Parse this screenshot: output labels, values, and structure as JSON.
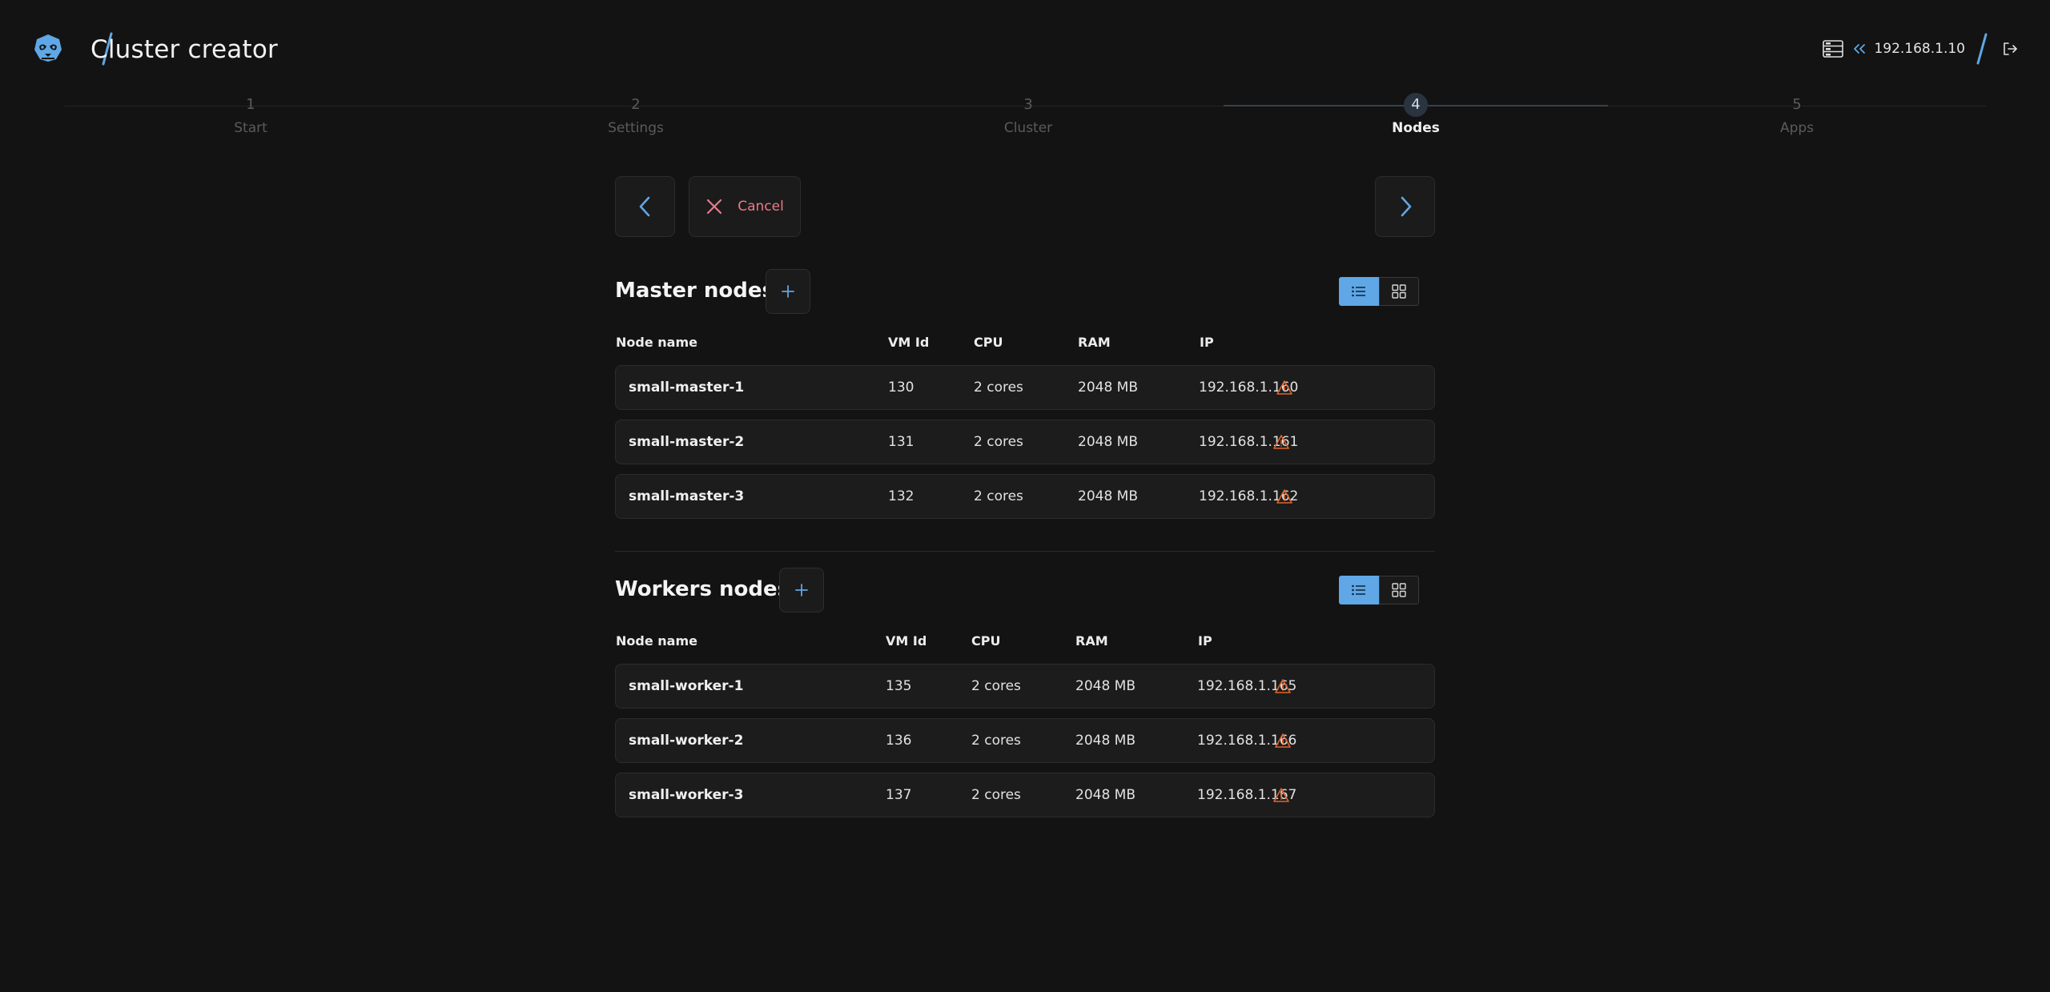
{
  "header": {
    "title": "Cluster creator",
    "host": "192.168.1.10"
  },
  "colors": {
    "accent": "#5fa7e6",
    "cancel": "#e97a8a",
    "warning": "#e0642c",
    "background": "#131313"
  },
  "steps": [
    {
      "num": "1",
      "label": "Start"
    },
    {
      "num": "2",
      "label": "Settings"
    },
    {
      "num": "3",
      "label": "Cluster"
    },
    {
      "num": "4",
      "label": "Nodes"
    },
    {
      "num": "5",
      "label": "Apps"
    }
  ],
  "nav": {
    "cancel_label": "Cancel"
  },
  "master": {
    "title": "Master nodes",
    "columns": [
      "Node name",
      "VM Id",
      "CPU",
      "RAM",
      "IP"
    ],
    "rows": [
      {
        "name": "small-master-1",
        "vmid": "130",
        "cpu": "2 cores",
        "ram": "2048 MB",
        "ip": "192.168.1.160"
      },
      {
        "name": "small-master-2",
        "vmid": "131",
        "cpu": "2 cores",
        "ram": "2048 MB",
        "ip": "192.168.1.161"
      },
      {
        "name": "small-master-3",
        "vmid": "132",
        "cpu": "2 cores",
        "ram": "2048 MB",
        "ip": "192.168.1.162"
      }
    ]
  },
  "workers": {
    "title": "Workers nodes",
    "columns": [
      "Node name",
      "VM Id",
      "CPU",
      "RAM",
      "IP"
    ],
    "rows": [
      {
        "name": "small-worker-1",
        "vmid": "135",
        "cpu": "2 cores",
        "ram": "2048 MB",
        "ip": "192.168.1.165"
      },
      {
        "name": "small-worker-2",
        "vmid": "136",
        "cpu": "2 cores",
        "ram": "2048 MB",
        "ip": "192.168.1.166"
      },
      {
        "name": "small-worker-3",
        "vmid": "137",
        "cpu": "2 cores",
        "ram": "2048 MB",
        "ip": "192.168.1.167"
      }
    ]
  }
}
